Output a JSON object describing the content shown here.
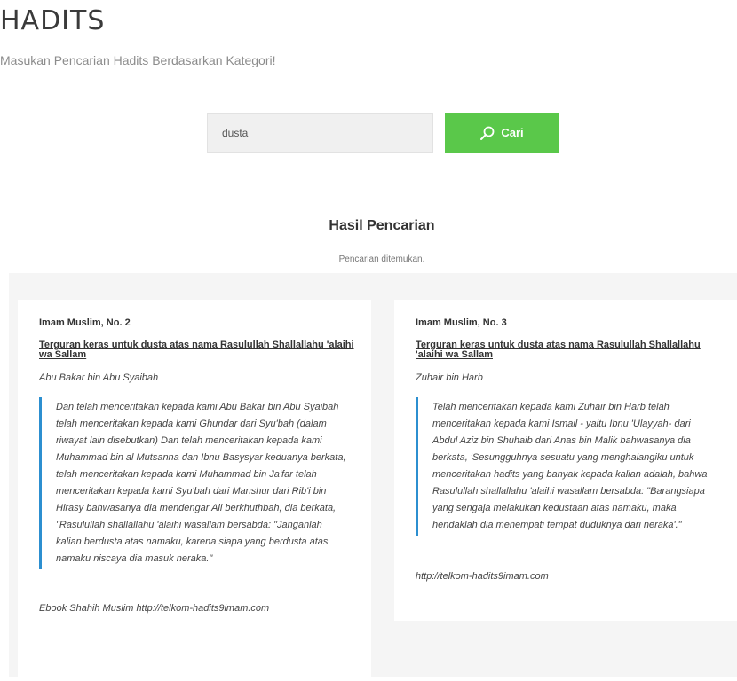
{
  "header": {
    "title": "HADITS",
    "subtitle": "Masukan Pencarian Hadits Berdasarkan Kategori!"
  },
  "search": {
    "value": "dusta",
    "button_label": "Cari",
    "button_icon": "search-icon",
    "button_color": "#5ac84a"
  },
  "results": {
    "title": "Hasil Pencarian",
    "status": "Pencarian ditemukan.",
    "accent_color": "#2c8fd0",
    "cards": [
      {
        "number": "Imam Muslim, No. 2",
        "topic": "Terguran keras untuk dusta atas nama Rasulullah Shallallahu 'alaihi wa Sallam",
        "narrator": "Abu Bakar bin Abu Syaibah",
        "text": "Dan telah menceritakan kepada kami Abu Bakar bin Abu Syaibah telah menceritakan kepada kami Ghundar dari Syu'bah (dalam riwayat lain disebutkan) Dan telah menceritakan kepada kami Muhammad bin al Mutsanna dan Ibnu Basysyar keduanya berkata, telah menceritakan kepada kami Muhammad bin Ja'far telah menceritakan kepada kami Syu'bah dari Manshur dari Rib'i bin Hirasy bahwasanya dia mendengar Ali berkhuthbah, dia berkata, \"Rasulullah shallallahu 'alaihi wasallam bersabda: \"Janganlah kalian berdusta atas namaku, karena siapa yang berdusta atas namaku niscaya dia masuk neraka.\"",
        "source": "Ebook Shahih Muslim http://telkom-hadits9imam.com"
      },
      {
        "number": "Imam Muslim, No. 3",
        "topic": "Terguran keras untuk dusta atas nama Rasulullah Shallallahu 'alaihi wa Sallam",
        "narrator": "Zuhair bin Harb",
        "text": "Telah menceritakan kepada kami Zuhair bin Harb telah menceritakan kepada kami Ismail - yaitu Ibnu 'Ulayyah- dari Abdul Aziz bin Shuhaib dari Anas bin Malik bahwasanya dia berkata, 'Sesungguhnya sesuatu yang menghalangiku untuk menceritakan hadits yang banyak kepada kalian adalah, bahwa Rasulullah shallallahu 'alaihi wasallam bersabda: \"Barangsiapa yang sengaja melakukan kedustaan atas namaku, maka hendaklah dia menempati tempat duduknya dari neraka'.\"",
        "source": "http://telkom-hadits9imam.com"
      }
    ]
  }
}
